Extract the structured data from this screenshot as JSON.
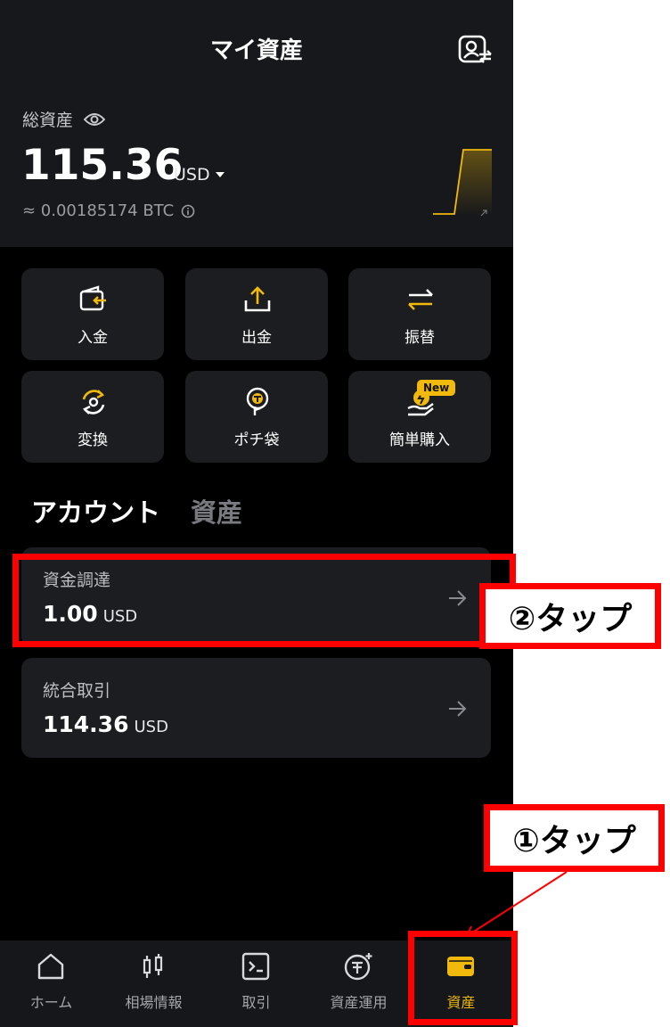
{
  "header": {
    "title": "マイ資産"
  },
  "summary": {
    "total_label": "総資産",
    "total_value": "115.36",
    "currency": "USD",
    "btc_equivalent": "≈ 0.00185174 BTC"
  },
  "actions": [
    {
      "label": "入金",
      "icon": "deposit-icon"
    },
    {
      "label": "出金",
      "icon": "withdraw-icon"
    },
    {
      "label": "振替",
      "icon": "transfer-icon"
    },
    {
      "label": "変換",
      "icon": "convert-icon"
    },
    {
      "label": "ポチ袋",
      "icon": "red-packet-icon"
    },
    {
      "label": "簡単購入",
      "icon": "buy-crypto-icon",
      "badge": "New"
    }
  ],
  "tabs": [
    {
      "label": "アカウント",
      "active": true
    },
    {
      "label": "資産",
      "active": false
    }
  ],
  "accounts": [
    {
      "label": "資金調達",
      "value": "1.00",
      "unit": "USD"
    },
    {
      "label": "統合取引",
      "value": "114.36",
      "unit": "USD"
    }
  ],
  "nav": [
    {
      "label": "ホーム",
      "icon": "home-icon"
    },
    {
      "label": "相場情報",
      "icon": "candlestick-icon"
    },
    {
      "label": "取引",
      "icon": "trade-icon"
    },
    {
      "label": "資産運用",
      "icon": "earn-icon"
    },
    {
      "label": "資産",
      "icon": "wallet-icon",
      "active": true
    }
  ],
  "annotations": {
    "step1": "①タップ",
    "step2": "②タップ"
  },
  "colors": {
    "accent": "#f0b90b",
    "highlight": "#ff0000",
    "background": "#000000",
    "card": "#1c1d21"
  }
}
